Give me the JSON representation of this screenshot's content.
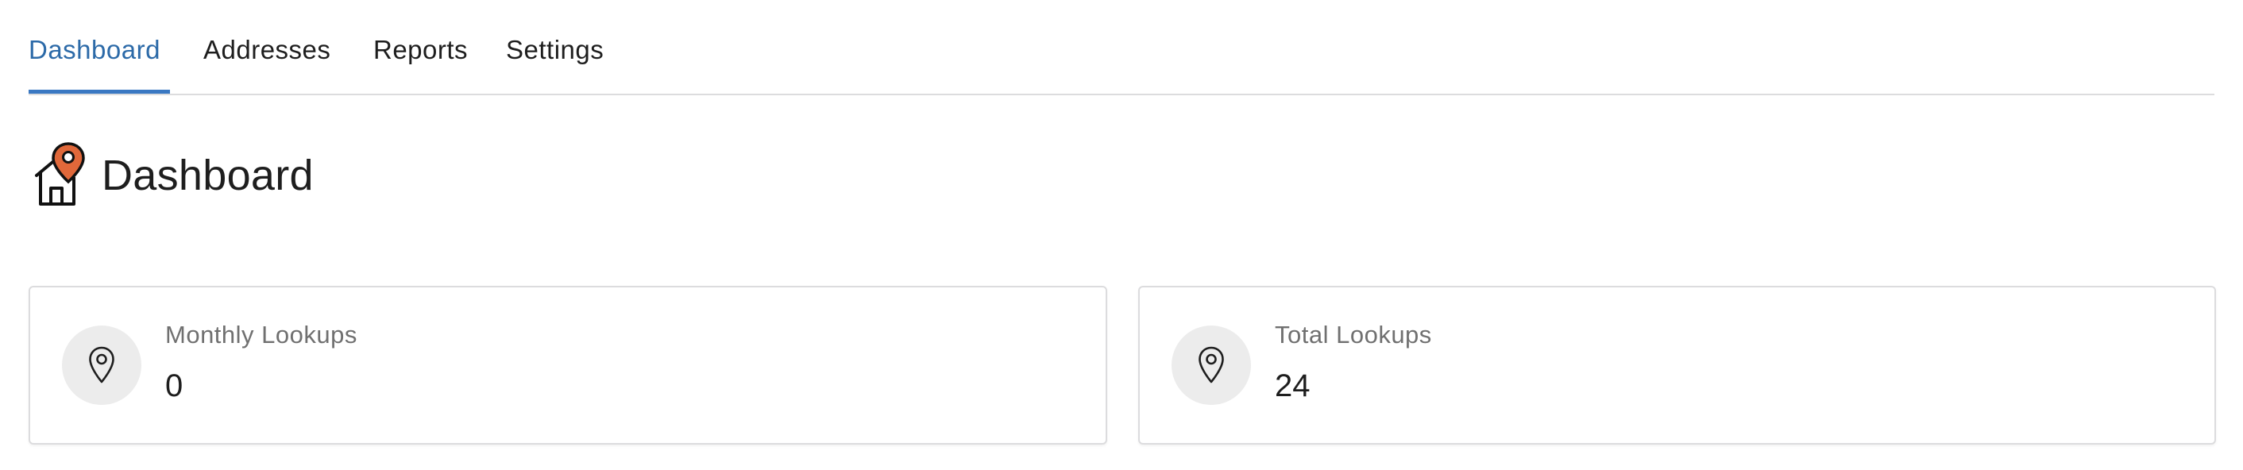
{
  "tabs": [
    {
      "label": "Dashboard",
      "active": true
    },
    {
      "label": "Addresses",
      "active": false
    },
    {
      "label": "Reports",
      "active": false
    },
    {
      "label": "Settings",
      "active": false
    }
  ],
  "page": {
    "title": "Dashboard",
    "icon": "house-location-pin-icon"
  },
  "stats": [
    {
      "label": "Monthly Lookups",
      "value": "0",
      "icon": "location-pin-icon"
    },
    {
      "label": "Total Lookups",
      "value": "24",
      "icon": "location-pin-icon"
    }
  ],
  "colors": {
    "accent": "#3a78c2",
    "active_tab_text": "#2c6aa8",
    "pin_orange": "#e0683a",
    "icon_circle_bg": "#ececec",
    "border": "#dcdcde"
  }
}
